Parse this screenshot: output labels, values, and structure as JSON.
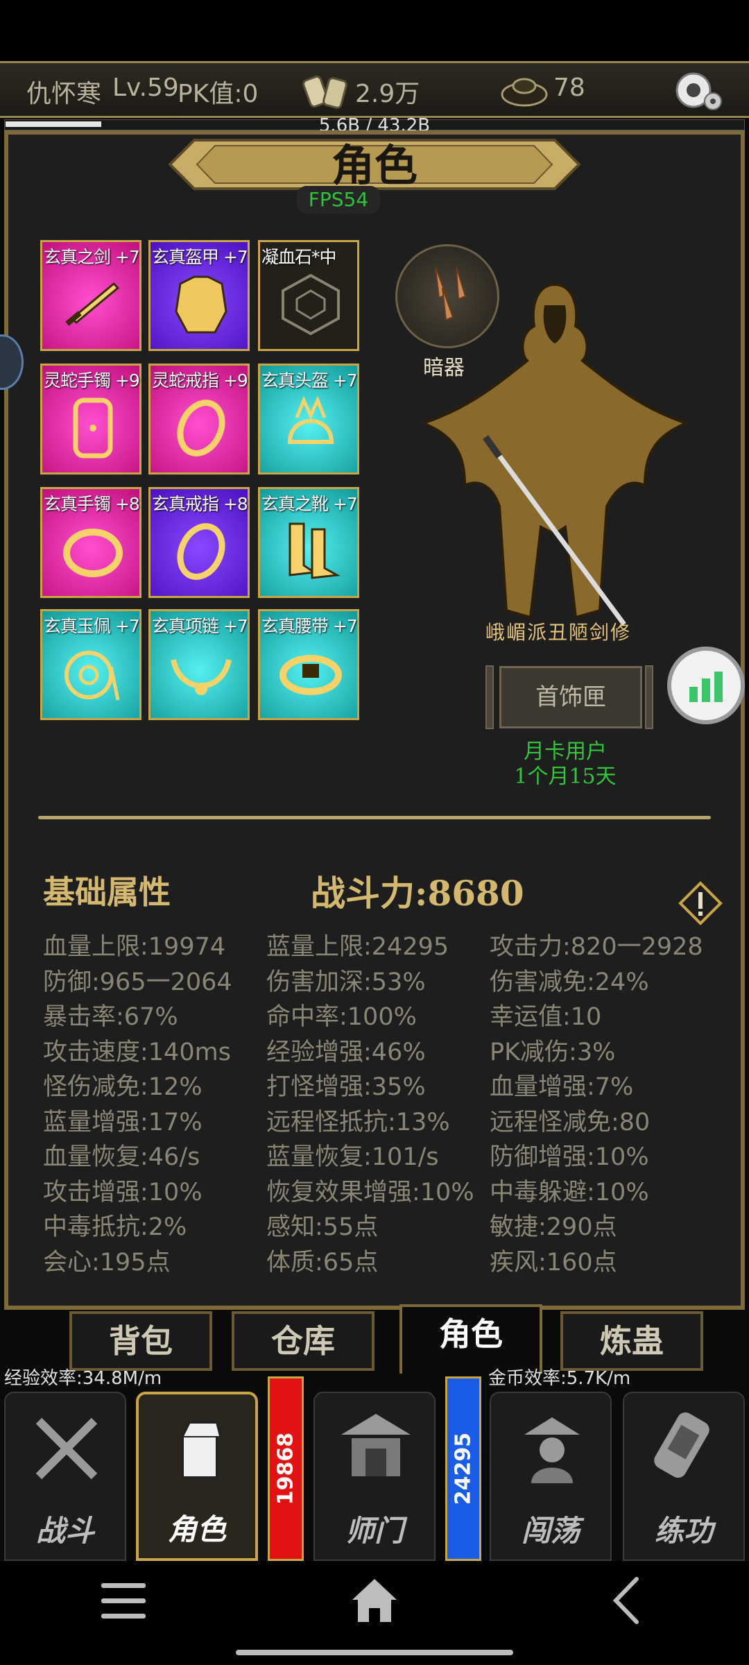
{
  "header": {
    "player_name": "仇怀寒",
    "level": "Lv.59",
    "pk": "PK值:0",
    "currency_amount": "2.9万",
    "ingot_amount": "78"
  },
  "storage": {
    "usage_text": "5.6B / 43.2B",
    "fill_fraction": 0.13
  },
  "page": {
    "title": "角色",
    "fps": "FPS54"
  },
  "equipment": [
    {
      "label": "玄真之剑 +7",
      "icon": "sword-icon",
      "bg": "magenta"
    },
    {
      "label": "玄真盔甲 +7",
      "icon": "armor-icon",
      "bg": "purple"
    },
    {
      "label": "凝血石*中",
      "icon": "gem-icon",
      "bg": "dark"
    },
    {
      "label": "灵蛇手镯 +9",
      "icon": "bracer-icon",
      "bg": "magenta"
    },
    {
      "label": "灵蛇戒指 +9",
      "icon": "ring-icon",
      "bg": "magenta"
    },
    {
      "label": "玄真头盔 +7",
      "icon": "helmet-icon",
      "bg": "cyan"
    },
    {
      "label": "玄真手镯 +8",
      "icon": "bracelet-icon",
      "bg": "magenta"
    },
    {
      "label": "玄真戒指 +8",
      "icon": "ring-icon",
      "bg": "purple"
    },
    {
      "label": "玄真之靴 +7",
      "icon": "boots-icon",
      "bg": "cyan"
    },
    {
      "label": "玄真玉佩 +7",
      "icon": "jade-pendant-icon",
      "bg": "cyan"
    },
    {
      "label": "玄真项链 +7",
      "icon": "necklace-icon",
      "bg": "cyan"
    },
    {
      "label": "玄真腰带 +7",
      "icon": "belt-icon",
      "bg": "cyan"
    }
  ],
  "character": {
    "hidden_weapon_label": "暗器",
    "sect_label": "峨嵋派丑陋剑修",
    "jewelry_box_button": "首饰匣",
    "membership": "月卡用户",
    "membership_remaining": "1个月15天"
  },
  "stats": {
    "heading": "基础属性",
    "combat_power": "战斗力:8680",
    "columns": [
      [
        "血量上限:19974",
        "防御:965一2064",
        "暴击率:67%",
        "攻击速度:140ms",
        "怪伤减免:12%",
        "蓝量增强:17%",
        "血量恢复:46/s",
        "攻击增强:10%",
        "中毒抵抗:2%",
        "会心:195点"
      ],
      [
        "蓝量上限:24295",
        "伤害加深:53%",
        "命中率:100%",
        "经验增强:46%",
        "打怪增强:35%",
        "远程怪抵抗:13%",
        "蓝量恢复:101/s",
        "恢复效果增强:10%",
        "感知:55点",
        "体质:65点"
      ],
      [
        "攻击力:820一2928",
        "伤害减免:24%",
        "幸运值:10",
        "PK减伤:3%",
        "血量增强:7%",
        "远程怪减免:80",
        "防御增强:10%",
        "中毒躲避:10%",
        "敏捷:290点",
        "疾风:160点"
      ]
    ]
  },
  "tabs": [
    "背包",
    "仓库",
    "角色",
    "炼蛊"
  ],
  "rates": {
    "exp": "经验效率:34.8M/m",
    "gold": "金币效率:5.7K/m"
  },
  "bottom_nav": [
    "战斗",
    "角色",
    "师门",
    "闯荡",
    "练功"
  ],
  "vitals": {
    "hp": "19868",
    "mp": "24295"
  },
  "colors": {
    "gold": "#c9a545",
    "hp_bar": "#e31212",
    "mp_bar": "#1a5ce8",
    "green": "#33c63d"
  }
}
